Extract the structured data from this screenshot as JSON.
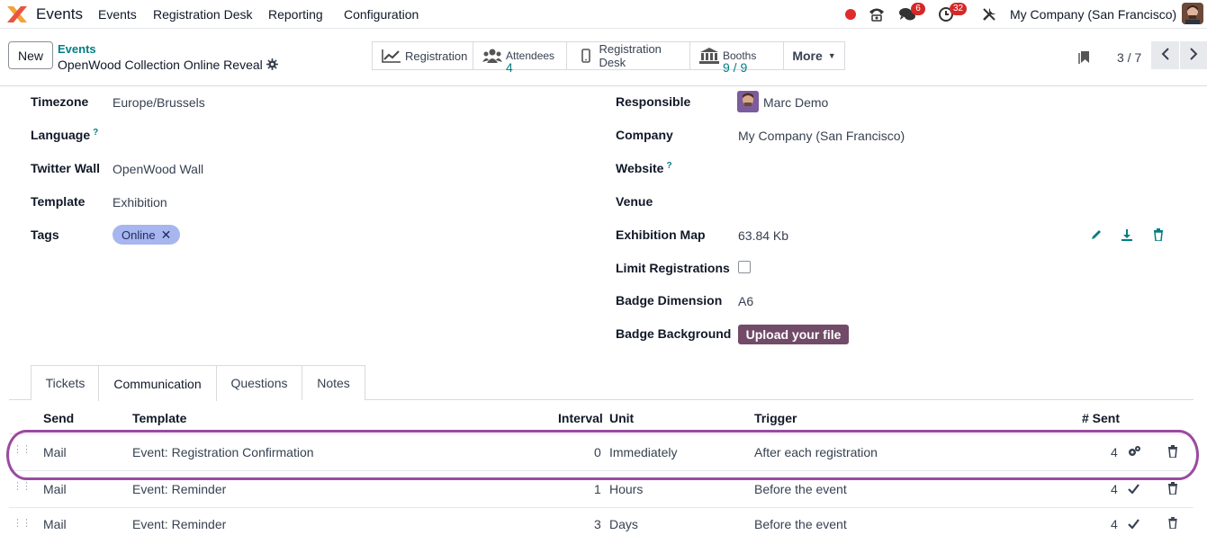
{
  "topbar": {
    "app_name": "Events",
    "menus": [
      "Events",
      "Registration Desk",
      "Reporting",
      "Configuration"
    ],
    "messages_badge": "6",
    "activities_badge": "32",
    "company": "My Company (San Francisco)"
  },
  "control": {
    "new_label": "New",
    "breadcrumb_parent": "Events",
    "breadcrumb_current": "OpenWood Collection Online Reveal",
    "smart_buttons": {
      "registration": "Registration",
      "attendees_label": "Attendees",
      "attendees_value": "4",
      "registration_desk": "Registration Desk",
      "booths_label": "Booths",
      "booths_value": "9 / 9",
      "more": "More"
    },
    "pager": "3 / 7"
  },
  "form": {
    "left": {
      "timezone_label": "Timezone",
      "timezone_value": "Europe/Brussels",
      "language_label": "Language",
      "twitter_label": "Twitter Wall",
      "twitter_value": "OpenWood Wall",
      "template_label": "Template",
      "template_value": "Exhibition",
      "tags_label": "Tags",
      "tag_online": "Online"
    },
    "right": {
      "responsible_label": "Responsible",
      "responsible_value": "Marc Demo",
      "company_label": "Company",
      "company_value": "My Company (San Francisco)",
      "website_label": "Website",
      "venue_label": "Venue",
      "map_label": "Exhibition Map",
      "map_value": "63.84 Kb",
      "limit_label": "Limit Registrations",
      "limit_checked": false,
      "badge_dim_label": "Badge Dimension",
      "badge_dim_value": "A6",
      "badge_bg_label": "Badge Background",
      "upload_label": "Upload your file"
    },
    "help_mark": "?"
  },
  "tabs": [
    "Tickets",
    "Communication",
    "Questions",
    "Notes"
  ],
  "active_tab": "Communication",
  "table": {
    "headers": {
      "send": "Send",
      "template": "Template",
      "interval": "Interval",
      "unit": "Unit",
      "trigger": "Trigger",
      "sent": "# Sent"
    },
    "rows": [
      {
        "send": "Mail",
        "template": "Event: Registration Confirmation",
        "interval": "0",
        "unit": "Immediately",
        "trigger": "After each registration",
        "sent": "4",
        "status_icon": "gears-icon"
      },
      {
        "send": "Mail",
        "template": "Event: Reminder",
        "interval": "1",
        "unit": "Hours",
        "trigger": "Before the event",
        "sent": "4",
        "status_icon": "check-icon"
      },
      {
        "send": "Mail",
        "template": "Event: Reminder",
        "interval": "3",
        "unit": "Days",
        "trigger": "Before the event",
        "sent": "4",
        "status_icon": "check-icon"
      }
    ]
  },
  "colors": {
    "accent": "#017e84",
    "primary": "#714b67",
    "highlight_ring": "#9b4aa0",
    "tag": "#a7b6ef",
    "badge": "#d62828"
  }
}
